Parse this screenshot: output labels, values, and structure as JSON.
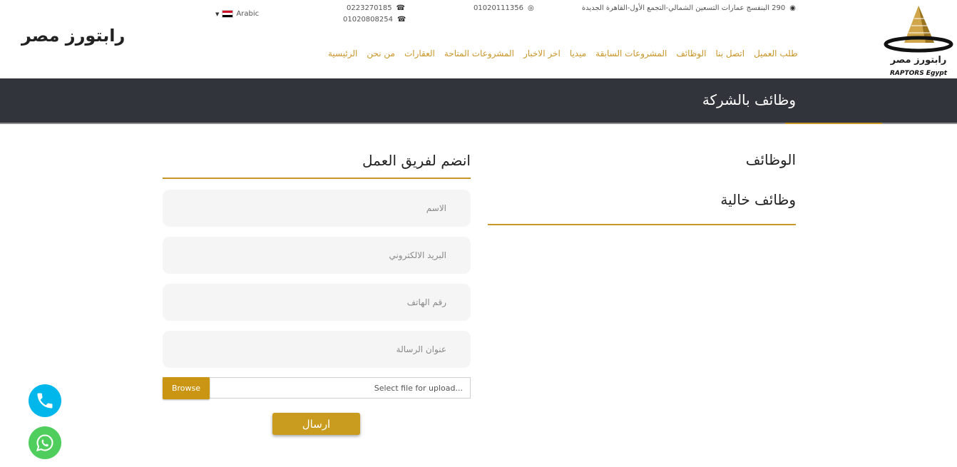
{
  "header": {
    "brand_text": "رابتورز مصر",
    "logo": {
      "title": "رابتورز مصر",
      "subtitle": "RAPTORS Egypt"
    },
    "address": "290 البنفسج عمارات التسعين الشمالي-التجمع الأول-القاهرة الجديدة",
    "address_icon": "map-pin-icon",
    "whatsapp_number": "01020111356",
    "whatsapp_icon": "whatsapp-icon",
    "phone_1": "0223270185",
    "phone_2": "01020808254",
    "phone_icon": "phone-icon",
    "language": "Arabic",
    "language_flag": "egypt-flag-icon"
  },
  "nav": {
    "items": [
      {
        "label": "الرئيسية"
      },
      {
        "label": "من نحن"
      },
      {
        "label": "العقارات"
      },
      {
        "label": "المشروعات المتاحة"
      },
      {
        "label": "اخر الاخبار"
      },
      {
        "label": "ميديا"
      },
      {
        "label": "المشروعات السابقة"
      },
      {
        "label": "الوظائف"
      },
      {
        "label": "اتصل بنا"
      },
      {
        "label": "طلب العميل"
      }
    ]
  },
  "banner": {
    "title": "وظائف بالشركة"
  },
  "jobs": {
    "title": "الوظائف",
    "empty_text": "وظائف خالية"
  },
  "form": {
    "title": "انضم لفريق العمل",
    "name_placeholder": "الاسم",
    "email_placeholder": "البريد الالكتروني",
    "phone_placeholder": "رقم الهاتف",
    "subject_placeholder": "عنوان الرسالة",
    "browse_label": "Browse",
    "upload_placeholder": "Select file for upload...",
    "submit_label": "ارسال"
  },
  "floating": {
    "call_icon": "phone-call-icon",
    "whatsapp_icon": "whatsapp-icon"
  },
  "colors": {
    "accent": "#c9962a",
    "banner_bg": "#31343a",
    "call_btn": "#00b7ec",
    "whatsapp_btn": "#4fce5d",
    "button_gold": "#c99513"
  }
}
